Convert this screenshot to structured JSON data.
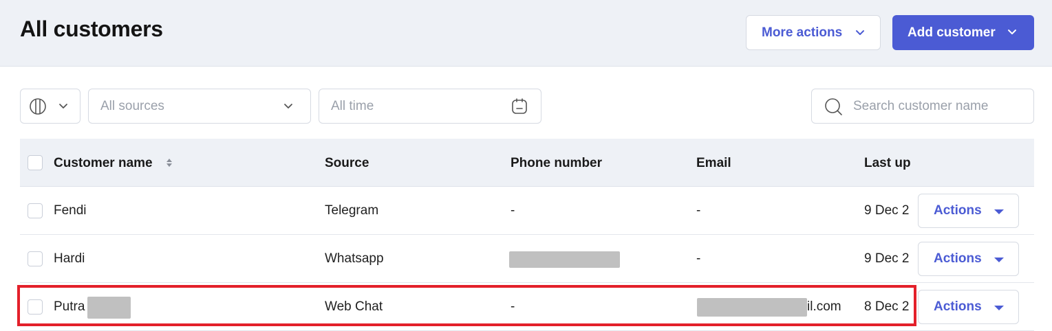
{
  "header": {
    "title": "All customers",
    "more_actions_label": "More actions",
    "add_customer_label": "Add customer"
  },
  "filters": {
    "sources_placeholder": "All sources",
    "time_placeholder": "All time",
    "search_placeholder": "Search customer name"
  },
  "table": {
    "columns": [
      "Customer name",
      "Source",
      "Phone number",
      "Email",
      "Last up"
    ],
    "rows": [
      {
        "name": "Fendi",
        "source": "Telegram",
        "phone": "-",
        "email": "-",
        "last_updated": "9 Dec 2",
        "action_label": "Actions"
      },
      {
        "name": "Hardi",
        "source": "Whatsapp",
        "phone": "",
        "email": "-",
        "last_updated": "9 Dec 2",
        "action_label": "Actions"
      },
      {
        "name": "Putra",
        "source": "Web Chat",
        "phone": "-",
        "email": "il.com",
        "last_updated": "8 Dec 2",
        "action_label": "Actions"
      }
    ]
  },
  "colors": {
    "accent": "#4b5bd4",
    "highlight": "#e3202a",
    "redaction": "#c0c0c0"
  }
}
